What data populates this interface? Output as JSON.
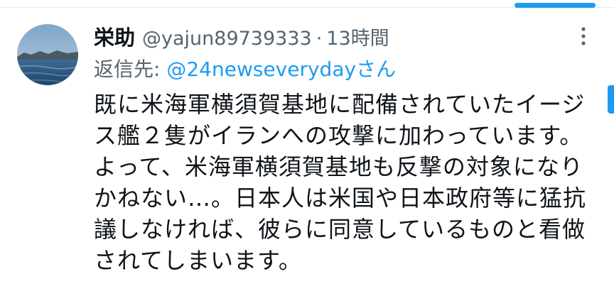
{
  "tweet": {
    "display_name": "栄助",
    "handle": "@yajun89739333",
    "separator": "·",
    "time": "13時間",
    "reply_label": "返信先: ",
    "reply_target": "@24newseverydayさん",
    "text_lines": [
      "既に米海軍横須賀基地に配備されていたイージ",
      "ス艦２隻がイランへの攻撃に加わっています。",
      "よって、米海軍横須賀基地も反撃の対象になり",
      "かねない…。日本人は米国や日本政府等に猛抗",
      "議しなければ、彼らに同意しているものと看做",
      "されてしまいます。"
    ]
  },
  "icons": {
    "more": "more-vertical-icon",
    "avatar": "landscape-photo"
  },
  "colors": {
    "accent": "#1d9bf0",
    "secondary_text": "#536471",
    "primary_text": "#0f1419"
  }
}
